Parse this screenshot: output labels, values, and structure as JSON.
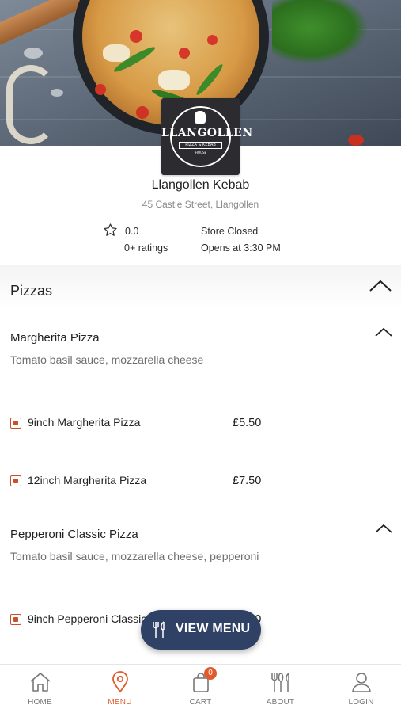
{
  "store": {
    "name": "Llangollen Kebab",
    "address": "45 Castle Street, Llangollen",
    "rating": "0.0",
    "ratings_count": "0+ ratings",
    "status": "Store Closed",
    "opens_at": "Opens at 3:30 PM",
    "logo": {
      "brand": "LLANGOLLEN",
      "sub": "PIZZA & KEBAB",
      "sub2": "HOUSE"
    }
  },
  "category": {
    "title": "Pizzas"
  },
  "items": [
    {
      "title": "Margherita Pizza",
      "description": "Tomato basil sauce, mozzarella cheese",
      "options": [
        {
          "label": "9inch Margherita Pizza",
          "price": "£5.50"
        },
        {
          "label": "12inch Margherita Pizza",
          "price": "£7.50"
        }
      ]
    },
    {
      "title": "Pepperoni Classic Pizza",
      "description": "Tomato basil sauce, mozzarella cheese, pepperoni",
      "options": [
        {
          "label": "9inch Pepperoni Classic Pizza",
          "price": "£7.50"
        }
      ]
    }
  ],
  "view_menu": {
    "label": "VIEW MENU",
    "icon": "cutlery-icon"
  },
  "bottom_nav": {
    "items": [
      {
        "label": "HOME",
        "icon": "home-icon",
        "active": false
      },
      {
        "label": "MENU",
        "icon": "location-pin-icon",
        "active": true
      },
      {
        "label": "CART",
        "icon": "shopping-bag-icon",
        "active": false
      },
      {
        "label": "ABOUT",
        "icon": "cutlery-icon",
        "active": false
      },
      {
        "label": "LOGIN",
        "icon": "user-icon",
        "active": false
      }
    ],
    "cart_count": "0"
  },
  "colors": {
    "accent": "#e05a2b",
    "option_marker": "#c9502a",
    "view_menu_bg": "#2f4266"
  }
}
